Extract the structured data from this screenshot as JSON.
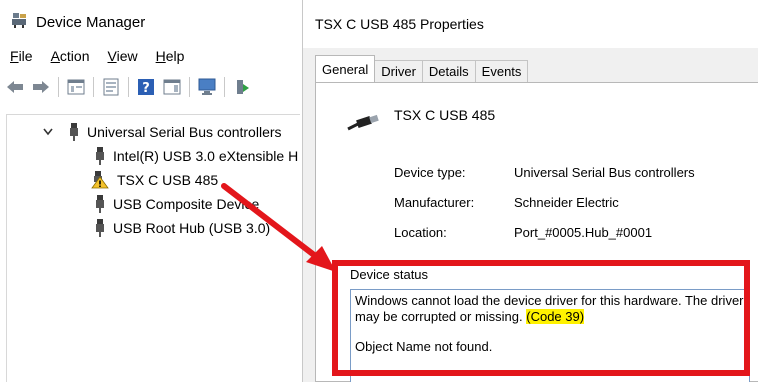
{
  "device_manager": {
    "title": "Device Manager",
    "menu": [
      "File",
      "Action",
      "View",
      "Help"
    ],
    "tree": {
      "category": "Universal Serial Bus controllers",
      "items": [
        {
          "label": "Intel(R) USB 3.0 eXtensible H",
          "icon": "usb-plug-icon"
        },
        {
          "label": "TSX C USB 485",
          "icon": "warning-icon"
        },
        {
          "label": "USB Composite Device",
          "icon": "usb-plug-icon"
        },
        {
          "label": "USB Root Hub (USB 3.0)",
          "icon": "usb-plug-icon"
        }
      ]
    }
  },
  "properties": {
    "title": "TSX C USB 485 Properties",
    "tabs": [
      "General",
      "Driver",
      "Details",
      "Events"
    ],
    "active_tab": "General",
    "device_name": "TSX C USB 485",
    "fields": [
      {
        "label": "Device type:",
        "value": "Universal Serial Bus controllers"
      },
      {
        "label": "Manufacturer:",
        "value": "Schneider Electric"
      },
      {
        "label": "Location:",
        "value": "Port_#0005.Hub_#0001"
      }
    ],
    "status": {
      "legend": "Device status",
      "message": "Windows cannot load the device driver for this hardware. The driver may be corrupted or missing.",
      "code": "(Code 39)",
      "detail": "Object Name not found."
    }
  },
  "colors": {
    "annotation_red": "#e3161b",
    "highlight_yellow": "#fff200"
  }
}
